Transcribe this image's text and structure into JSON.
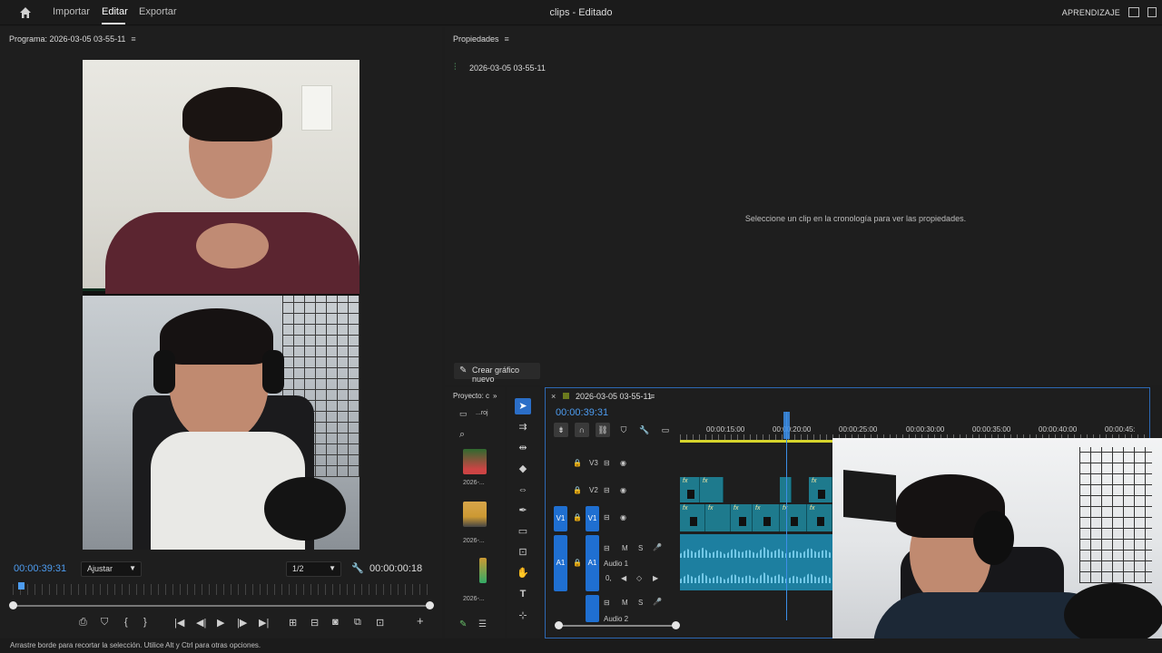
{
  "topbar": {
    "nav": [
      "Importar",
      "Editar",
      "Exportar"
    ],
    "active": "Editar",
    "title": "clips - Editado",
    "learn": "APRENDIZAJE"
  },
  "program": {
    "title": "Programa: 2026-03-05 03-55-11",
    "current_time": "00:00:39:31",
    "fit": "Ajustar",
    "quality": "1/2",
    "duration": "00:00:00:18"
  },
  "properties": {
    "title": "Propiedades",
    "sequence": "2026-03-05 03-55-11",
    "hint": "Seleccione un clip en la cronología para ver las propiedades.",
    "new_graphic": "Crear gráfico nuevo"
  },
  "project": {
    "title": "Proyecto: c",
    "folder": "...roj",
    "items": [
      "2026-...",
      "2026-...",
      "2026-..."
    ]
  },
  "timeline": {
    "sequence": "2026-03-05 03-55-11",
    "current_time": "00:00:39:31",
    "ticks": [
      "00:00:15:00",
      "00:00:20:00",
      "00:00:25:00",
      "00:00:30:00",
      "00:00:35:00",
      "00:00:40:00",
      "00:00:45:"
    ],
    "tracks": {
      "v3": "V3",
      "v2": "V2",
      "v1": "V1",
      "v1_src": "V1",
      "a1": "A1",
      "a1_src": "A1",
      "audio1": "Audio 1",
      "audio2": "Audio 2",
      "m": "M",
      "s": "S",
      "vol": "0,"
    }
  },
  "status": "Arrastre borde para recortar la selección. Utilice Alt y Ctrl para otras opciones."
}
